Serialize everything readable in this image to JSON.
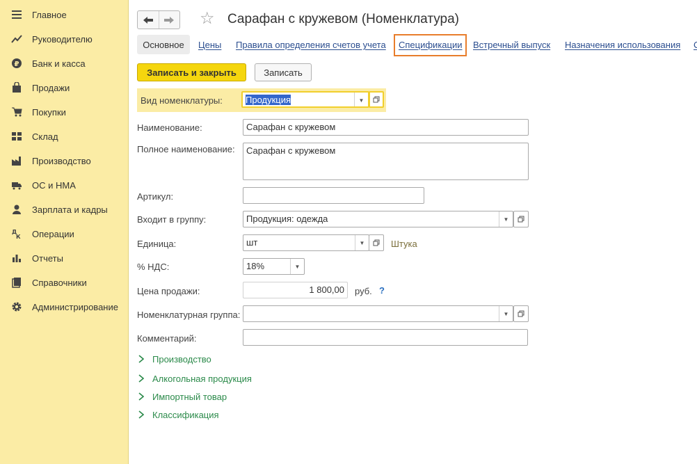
{
  "sidebar": {
    "items": [
      {
        "label": "Главное",
        "icon": "menu-lines-icon"
      },
      {
        "label": "Руководителю",
        "icon": "trend-line-icon"
      },
      {
        "label": "Банк и касса",
        "icon": "ruble-coin-icon"
      },
      {
        "label": "Продажи",
        "icon": "shopping-bag-icon"
      },
      {
        "label": "Покупки",
        "icon": "cart-icon"
      },
      {
        "label": "Склад",
        "icon": "warehouse-grid-icon"
      },
      {
        "label": "Производство",
        "icon": "factory-icon"
      },
      {
        "label": "ОС и НМА",
        "icon": "truck-icon"
      },
      {
        "label": "Зарплата и кадры",
        "icon": "person-icon"
      },
      {
        "label": "Операции",
        "icon": "debit-credit-icon"
      },
      {
        "label": "Отчеты",
        "icon": "bar-chart-icon"
      },
      {
        "label": "Справочники",
        "icon": "book-icon"
      },
      {
        "label": "Администрирование",
        "icon": "gear-icon"
      }
    ]
  },
  "header": {
    "title": "Сарафан с кружевом (Номенклатура)"
  },
  "tabs": [
    {
      "label": "Основное"
    },
    {
      "label": "Цены"
    },
    {
      "label": "Правила определения счетов учета"
    },
    {
      "label": "Спецификации"
    },
    {
      "label": "Встречный выпуск"
    },
    {
      "label": "Назначения использования"
    },
    {
      "label": "С"
    }
  ],
  "toolbar": {
    "save_close_label": "Записать и закрыть",
    "save_label": "Записать"
  },
  "form": {
    "kind_label": "Вид номенклатуры:",
    "kind_value": "Продукция",
    "name_label": "Наименование:",
    "name_value": "Сарафан с кружевом",
    "fullname_label": "Полное наименование:",
    "fullname_value": "Сарафан с кружевом",
    "article_label": "Артикул:",
    "article_value": "",
    "group_label": "Входит в группу:",
    "group_value": "Продукция: одежда",
    "unit_label": "Единица:",
    "unit_value": "шт",
    "unit_hint": "Штука",
    "vat_label": "% НДС:",
    "vat_value": "18%",
    "price_label": "Цена продажи:",
    "price_value": "1 800,00",
    "price_currency": "руб.",
    "price_help": "?",
    "nomgroup_label": "Номенклатурная группа:",
    "nomgroup_value": "",
    "comment_label": "Комментарий:",
    "comment_value": ""
  },
  "sections": [
    {
      "label": "Производство"
    },
    {
      "label": "Алкогольная продукция"
    },
    {
      "label": "Импортный товар"
    },
    {
      "label": "Классификация"
    }
  ],
  "colors": {
    "sidebar_bg": "#fbeca5",
    "primary_button": "#f5d60e",
    "link": "#2a4d8f",
    "section_link": "#2b8a4a",
    "tab_highlight": "#e87d2b"
  }
}
